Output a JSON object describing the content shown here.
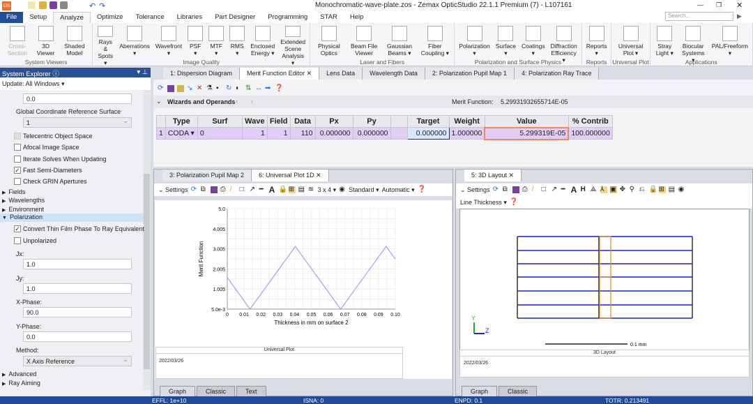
{
  "title": "Monochromatic-wave-plate.zos - Zemax OpticStudio 22.1.1    Premium (7) - L107161",
  "app_logo": "OS",
  "search_placeholder": "Search...",
  "menu": [
    "File",
    "Setup",
    "Analyze",
    "Optimize",
    "Tolerance",
    "Libraries",
    "Part Designer",
    "Programming",
    "STAR",
    "Help"
  ],
  "active_menu": "Analyze",
  "ribbon": [
    {
      "group": "System Viewers",
      "items": [
        "Cross-Section",
        "3D Viewer",
        "Shaded Model"
      ]
    },
    {
      "group": "Image Quality",
      "items": [
        "Rays & Spots ▾",
        "Aberrations ▾",
        "Wavefront ▾",
        "PSF ▾",
        "MTF ▾",
        "RMS ▾",
        "Enclosed Energy ▾",
        "Extended Scene Analysis ▾"
      ]
    },
    {
      "group": "Laser and Fibers",
      "items": [
        "Physical Optics",
        "Beam File Viewer",
        "Gaussian Beams ▾",
        "Fiber Coupling ▾"
      ]
    },
    {
      "group": "Polarization and Surface Physics",
      "items": [
        "Polarization ▾",
        "Surface ▾",
        "Coatings ▾",
        "Diffraction Efficiency ▾"
      ]
    },
    {
      "group": "Reports",
      "items": [
        "Reports ▾"
      ]
    },
    {
      "group": "Universal Plot",
      "items": [
        "Universal Plot ▾"
      ]
    },
    {
      "group": "Applications",
      "items": [
        "Stray Light ▾",
        "Biocular Systems ▾",
        "PAL/Freeform ▾"
      ]
    }
  ],
  "system_explorer": {
    "title": "System Explorer",
    "update": "Update: All Windows ▾",
    "top_value": "0.0",
    "gcrs_label": "Global Coordinate Reference Surface",
    "gcrs_value": "1",
    "checks": [
      {
        "label": "Telecentric Object Space",
        "checked": false
      },
      {
        "label": "Afocal Image Space",
        "checked": false
      },
      {
        "label": "Iterate Solves When Updating",
        "checked": false
      },
      {
        "label": "Fast Semi-Diameters",
        "checked": true
      },
      {
        "label": "Check GRIN Apertures",
        "checked": false
      }
    ],
    "sections": [
      "Fields",
      "Wavelengths",
      "Environment"
    ],
    "polarization": "Polarization",
    "pol_checks": [
      {
        "label": "Convert Thin Film Phase To Ray Equivalent",
        "checked": true
      },
      {
        "label": "Unpolarized",
        "checked": false
      }
    ],
    "fields": [
      {
        "label": "Jx:",
        "value": "1.0"
      },
      {
        "label": "Jy:",
        "value": "1.0"
      },
      {
        "label": "X-Phase:",
        "value": "90.0"
      },
      {
        "label": "Y-Phase:",
        "value": "0.0"
      }
    ],
    "method_label": "Method:",
    "method_value": "X Axis Reference",
    "after_sections": [
      "Advanced",
      "Ray Aiming"
    ]
  },
  "doc_tabs": [
    "1: Dispersion Diagram",
    "Merit Function Editor ✕",
    "Lens Data",
    "Wavelength Data",
    "2: Polarization Pupil Map 1",
    "4: Polarization Ray Trace"
  ],
  "active_doc_tab": 1,
  "mfe": {
    "wizards": "Wizards and Operands",
    "merit_label": "Merit Function:",
    "merit_value": "5.29931932655714E-05",
    "headers": [
      "",
      "Type",
      "Surf",
      "Wave",
      "Field",
      "Data",
      "Px",
      "Py",
      "",
      "Target",
      "Weight",
      "Value",
      "% Contrib"
    ],
    "row": [
      "1",
      "CODA ▾",
      "0",
      "1",
      "1",
      "110",
      "0.000000",
      "0.000000",
      "",
      "0.000000",
      "1.000000",
      "5.299319E-05",
      "100.000000"
    ]
  },
  "plot_pane": {
    "tabs": [
      "3: Polarization Pupil Map 2",
      "6: Universal Plot 1D ✕"
    ],
    "settings": "Settings",
    "grid": "3 x 4 ▾",
    "standard": "Standard ▾",
    "automatic": "Automatic ▾",
    "footer_title": "Universal Plot",
    "date": "2022/03/26",
    "bottom_tabs": [
      "Graph",
      "Classic",
      "Text"
    ]
  },
  "chart_data": {
    "type": "line",
    "xlabel": "Thickness in mm on surface 2",
    "ylabel": "Merit Function",
    "xlim": [
      0,
      0.1
    ],
    "ylim": [
      0.005,
      5.0
    ],
    "xticks": [
      "0",
      "0.01",
      "0.02",
      "0.03",
      "0.04",
      "0.05",
      "0.06",
      "0.07",
      "0.08",
      "0.09",
      "0.10"
    ],
    "yticks": [
      "5.0e-3",
      "1.005",
      "2.005",
      "3.005",
      "4.005",
      "5.0"
    ],
    "grid": true,
    "x": [
      0,
      0.0135,
      0.0405,
      0.0675,
      0.0945,
      0.1
    ],
    "y": [
      1.58,
      0.005,
      3.12,
      0.005,
      3.12,
      2.5
    ],
    "color": "#8f8ff0"
  },
  "layout_pane": {
    "tab": "5: 3D Layout ✕",
    "settings": "Settings",
    "line_thickness": "Line Thickness ▾",
    "scale": "0.1 mm",
    "axis_y": "Y",
    "axis_z": "Z",
    "footer_title": "3D Layout",
    "date": "2022/03/26",
    "bottom_tabs": [
      "Graph",
      "Classic"
    ]
  },
  "status": {
    "effl": "EFFL: 1e+10",
    "isna": "ISNA: 0",
    "enpd": "ENPD: 0.1",
    "totr": "TOTR: 0.213491"
  }
}
